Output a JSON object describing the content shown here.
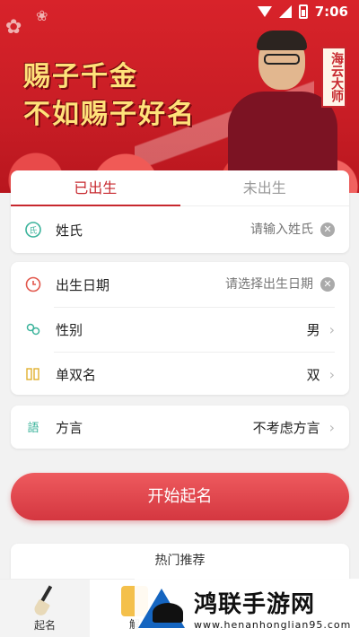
{
  "status_bar": {
    "time": "7:06"
  },
  "hero": {
    "slogan_line1": "赐子千金",
    "slogan_line2": "不如赐子好名",
    "master_title": "海云大师"
  },
  "tabs": [
    {
      "label": "已出生",
      "active": true
    },
    {
      "label": "未出生",
      "active": false
    }
  ],
  "form": {
    "surname": {
      "label": "姓氏",
      "placeholder": "请输入姓氏",
      "icon": "surname-icon"
    },
    "birth_date": {
      "label": "出生日期",
      "placeholder": "请选择出生日期",
      "icon": "clock-icon"
    },
    "gender": {
      "label": "性别",
      "value": "男",
      "icon": "gender-icon"
    },
    "name_length": {
      "label": "单双名",
      "value": "双",
      "icon": "name-length-icon"
    },
    "dialect": {
      "label": "方言",
      "value": "不考虑方言",
      "icon": "dialect-icon"
    }
  },
  "start_button": {
    "label": "开始起名"
  },
  "hot": {
    "title": "热门推荐"
  },
  "bottom_nav": [
    {
      "label": "起名",
      "active": true,
      "icon": "brush-icon"
    },
    {
      "label": "解",
      "active": false,
      "icon": "jie-icon"
    }
  ],
  "watermark": {
    "title": "鸿联手游网",
    "url": "www.henanhonglian95.com"
  },
  "colors": {
    "accent": "#c7282e",
    "button": "#e04a50",
    "placeholder": "#bbbbbb"
  }
}
